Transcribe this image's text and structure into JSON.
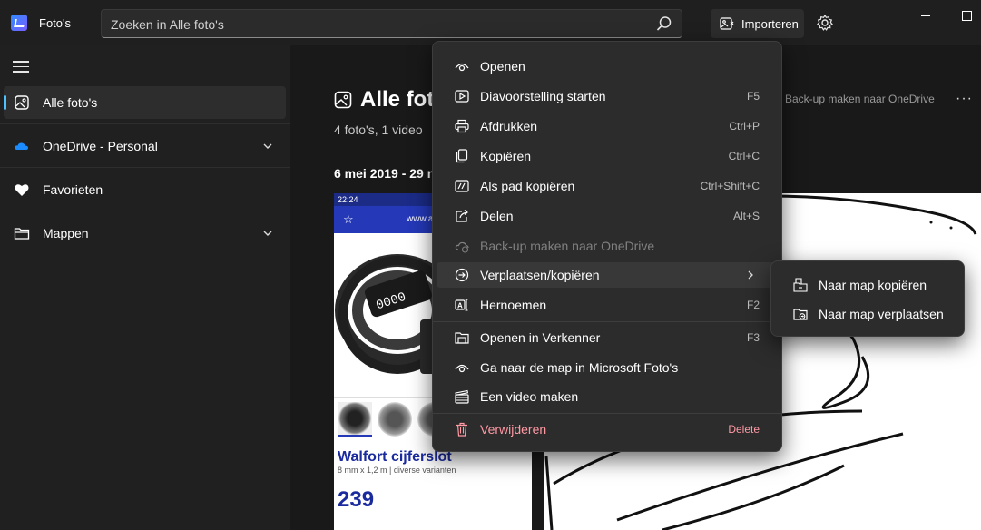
{
  "app": {
    "title": "Foto's"
  },
  "search": {
    "placeholder": "Zoeken in Alle foto's"
  },
  "toolbar": {
    "import_label": "Importeren"
  },
  "sidebar": {
    "items": [
      {
        "label": "Alle foto's",
        "icon": "photo-icon"
      },
      {
        "label": "OneDrive - Personal",
        "icon": "onedrive-icon"
      },
      {
        "label": "Favorieten",
        "icon": "heart-icon"
      },
      {
        "label": "Mappen",
        "icon": "folder-icon"
      }
    ]
  },
  "main": {
    "title": "Alle fot",
    "subtitle": "4 foto's, 1 video",
    "date_range": "6 mei 2019 - 29 n",
    "backup_link": "Back-up maken naar OneDrive",
    "more": "···"
  },
  "thumb1": {
    "status_time": "22:24",
    "url": "www.a",
    "product_name": "Walfort cijferslot",
    "product_desc": "8 mm x 1,2 m | diverse varianten",
    "price": "239"
  },
  "context_menu": {
    "items": [
      {
        "label": "Openen",
        "shortcut": "",
        "icon": "eye-icon"
      },
      {
        "label": "Diavoorstelling starten",
        "shortcut": "F5",
        "icon": "slideshow-icon"
      },
      {
        "label": "Afdrukken",
        "shortcut": "Ctrl+P",
        "icon": "printer-icon"
      },
      {
        "label": "Kopiëren",
        "shortcut": "Ctrl+C",
        "icon": "copy-icon"
      },
      {
        "label": "Als pad kopiëren",
        "shortcut": "Ctrl+Shift+C",
        "icon": "copy-path-icon"
      },
      {
        "label": "Delen",
        "shortcut": "Alt+S",
        "icon": "share-icon"
      },
      {
        "label": "Back-up maken naar OneDrive",
        "shortcut": "",
        "icon": "cloud-backup-icon"
      },
      {
        "label": "Verplaatsen/kopiëren",
        "shortcut": "",
        "icon": "move-icon"
      },
      {
        "label": "Hernoemen",
        "shortcut": "F2",
        "icon": "rename-icon"
      },
      {
        "label": "Openen in Verkenner",
        "shortcut": "F3",
        "icon": "explorer-icon"
      },
      {
        "label": "Ga naar de map in Microsoft Foto's",
        "shortcut": "",
        "icon": "eye-icon"
      },
      {
        "label": "Een video maken",
        "shortcut": "",
        "icon": "video-icon"
      },
      {
        "label": "Verwijderen",
        "shortcut": "Delete",
        "icon": "trash-icon"
      }
    ]
  },
  "submenu": {
    "items": [
      {
        "label": "Naar map kopiëren",
        "icon": "copy-to-folder-icon"
      },
      {
        "label": "Naar map verplaatsen",
        "icon": "move-to-folder-icon"
      }
    ]
  },
  "colors": {
    "accent": "#4cc2ff",
    "danger": "#ff99a4",
    "menu_bg": "#2c2c2c"
  }
}
